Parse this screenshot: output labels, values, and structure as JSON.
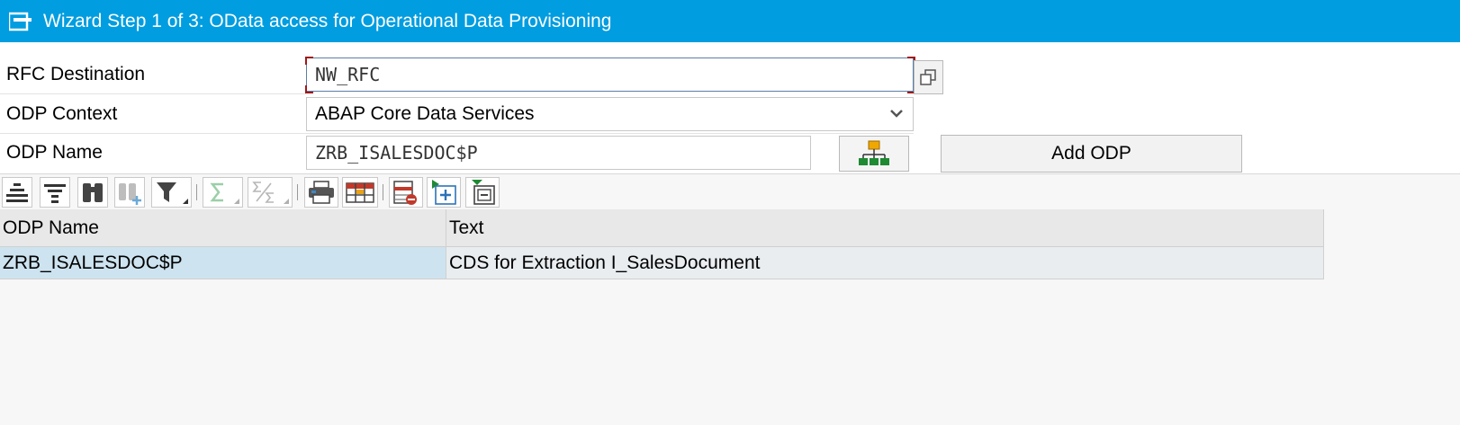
{
  "window": {
    "title": "Wizard Step 1 of 3: OData access for Operational Data Provisioning"
  },
  "form": {
    "rfc_destination": {
      "label": "RFC Destination",
      "value": "NW_RFC"
    },
    "odp_context": {
      "label": "ODP Context",
      "value": "ABAP Core Data Services"
    },
    "odp_name": {
      "label": "ODP Name",
      "value": "ZRB_ISALESDOC$P"
    },
    "add_odp_label": "Add ODP"
  },
  "grid": {
    "columns": [
      "ODP Name",
      "Text"
    ],
    "rows": [
      [
        "ZRB_ISALESDOC$P",
        "CDS for Extraction I_SalesDocument"
      ]
    ]
  },
  "colors": {
    "title_bar": "#009de0",
    "selected_cell": "#cde3ef",
    "hierarchy_icon_top": "#f0a800",
    "hierarchy_icon_bottom": "#1e8a32"
  },
  "toolbar_icons": [
    "align-center-icon",
    "filter-rows-icon",
    "binoculars-find-icon",
    "find-next-icon",
    "filter-icon",
    "sum-icon",
    "subtotal-icon",
    "print-icon",
    "layout-icon",
    "delete-row-icon",
    "insert-row-icon",
    "collapse-row-icon"
  ]
}
